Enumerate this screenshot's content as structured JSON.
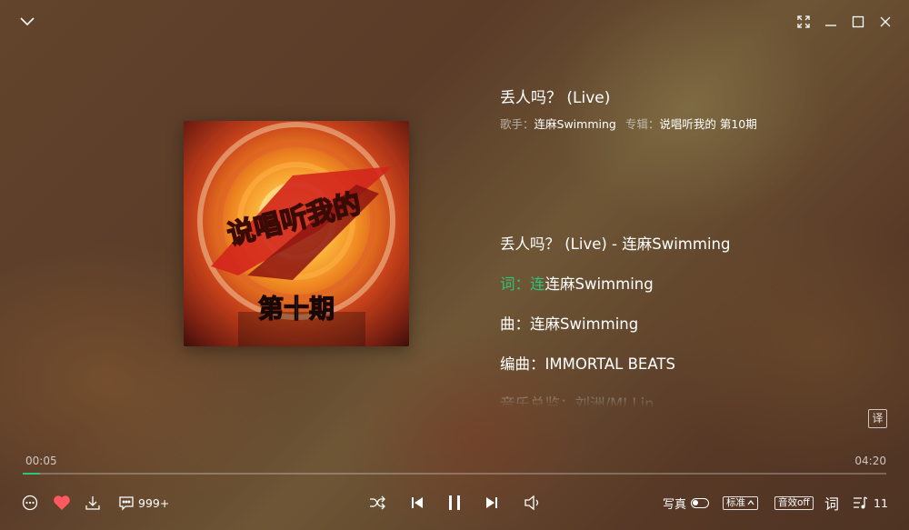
{
  "song": {
    "title": "丢人吗？ (Live)",
    "singer_label": "歌手：",
    "singer": "连麻Swimming",
    "album_label": "专辑：",
    "album": "说唱听我的 第10期"
  },
  "album_art": {
    "text": "第十期",
    "logo_text": "说唱听我的"
  },
  "lyrics": [
    {
      "text": "丢人吗？ (Live) - 连麻Swimming",
      "highlight": ""
    },
    {
      "text": "连麻Swimming",
      "highlight": "词：连"
    },
    {
      "text": "曲：连麻Swimming",
      "highlight": ""
    },
    {
      "text": "编曲：IMMORTAL BEATS",
      "highlight": ""
    },
    {
      "text": "音乐总监：刘洲/MJ Lin",
      "highlight": ""
    }
  ],
  "translate_label": "译",
  "playback": {
    "current_time": "00:05",
    "total_time": "04:20",
    "progress": 0.02
  },
  "bottom": {
    "comment_count": "999+",
    "photo_label": "写真",
    "quality_label": "标准",
    "effect_label": "音效off",
    "lyric_label": "词",
    "queue_count": "11"
  },
  "colors": {
    "accent": "#31c27c",
    "heart": "#ff5a5f"
  }
}
